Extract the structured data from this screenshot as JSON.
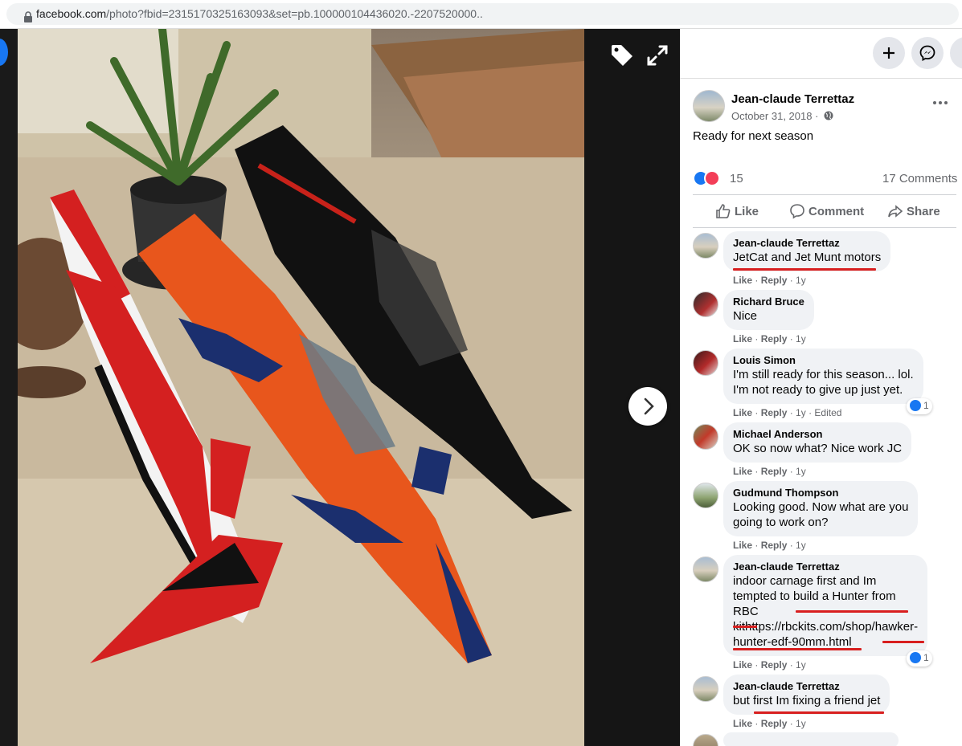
{
  "browser": {
    "url_domain": "facebook.com",
    "url_rest": "/photo?fbid=2315170325163093&set=pb.100000104436020.-2207520000.."
  },
  "viewer": {
    "tag_icon": "tag-icon",
    "expand_icon": "fullscreen-icon",
    "next_icon": "chevron-right-icon"
  },
  "topbar": {
    "create_icon": "plus-icon",
    "messenger_icon": "messenger-icon"
  },
  "post": {
    "author": "Jean-claude Terrettaz",
    "date": "October 31, 2018 · ",
    "text": "Ready for next season",
    "reaction_count": "15",
    "comments_count": "17 Comments",
    "actions": {
      "like": "Like",
      "comment": "Comment",
      "share": "Share"
    }
  },
  "comments": [
    {
      "author": "Jean-claude Terrettaz",
      "lines": [
        "JetCat and Jet Munt motors"
      ],
      "meta_like": "Like",
      "meta_reply": "Reply",
      "meta_time": "1y",
      "meta_extra": ""
    },
    {
      "author": "Richard Bruce",
      "lines": [
        "Nice"
      ],
      "meta_like": "Like",
      "meta_reply": "Reply",
      "meta_time": "1y",
      "meta_extra": ""
    },
    {
      "author": "Louis Simon",
      "lines": [
        "I'm still ready for this season... lol.",
        "I'm not ready to give up just yet."
      ],
      "meta_like": "Like",
      "meta_reply": "Reply",
      "meta_time": "1y",
      "meta_extra": "Edited",
      "reaction": "1"
    },
    {
      "author": "Michael Anderson",
      "lines": [
        "OK so now what? Nice work JC"
      ],
      "meta_like": "Like",
      "meta_reply": "Reply",
      "meta_time": "1y",
      "meta_extra": ""
    },
    {
      "author": "Gudmund Thompson",
      "lines": [
        "Looking good. Now what are you",
        "going to work on?"
      ],
      "meta_like": "Like",
      "meta_reply": "Reply",
      "meta_time": "1y",
      "meta_extra": ""
    },
    {
      "author": "Jean-claude Terrettaz",
      "lines": [
        "indoor carnage first and Im",
        "tempted to build a Hunter from",
        "RBC",
        "kithttps://rbckits.com/shop/hawker-",
        "hunter-edf-90mm.html"
      ],
      "meta_like": "Like",
      "meta_reply": "Reply",
      "meta_time": "1y",
      "meta_extra": "",
      "reaction": "1"
    },
    {
      "author": "Jean-claude Terrettaz",
      "lines": [
        "but first Im fixing a friend jet"
      ],
      "meta_like": "Like",
      "meta_reply": "Reply",
      "meta_time": "1y",
      "meta_extra": ""
    }
  ],
  "colors": {
    "fb_blue": "#1877f2",
    "love_red": "#f33e58",
    "annotation_red": "#d81f1f",
    "bubble_gray": "#f0f2f5"
  }
}
